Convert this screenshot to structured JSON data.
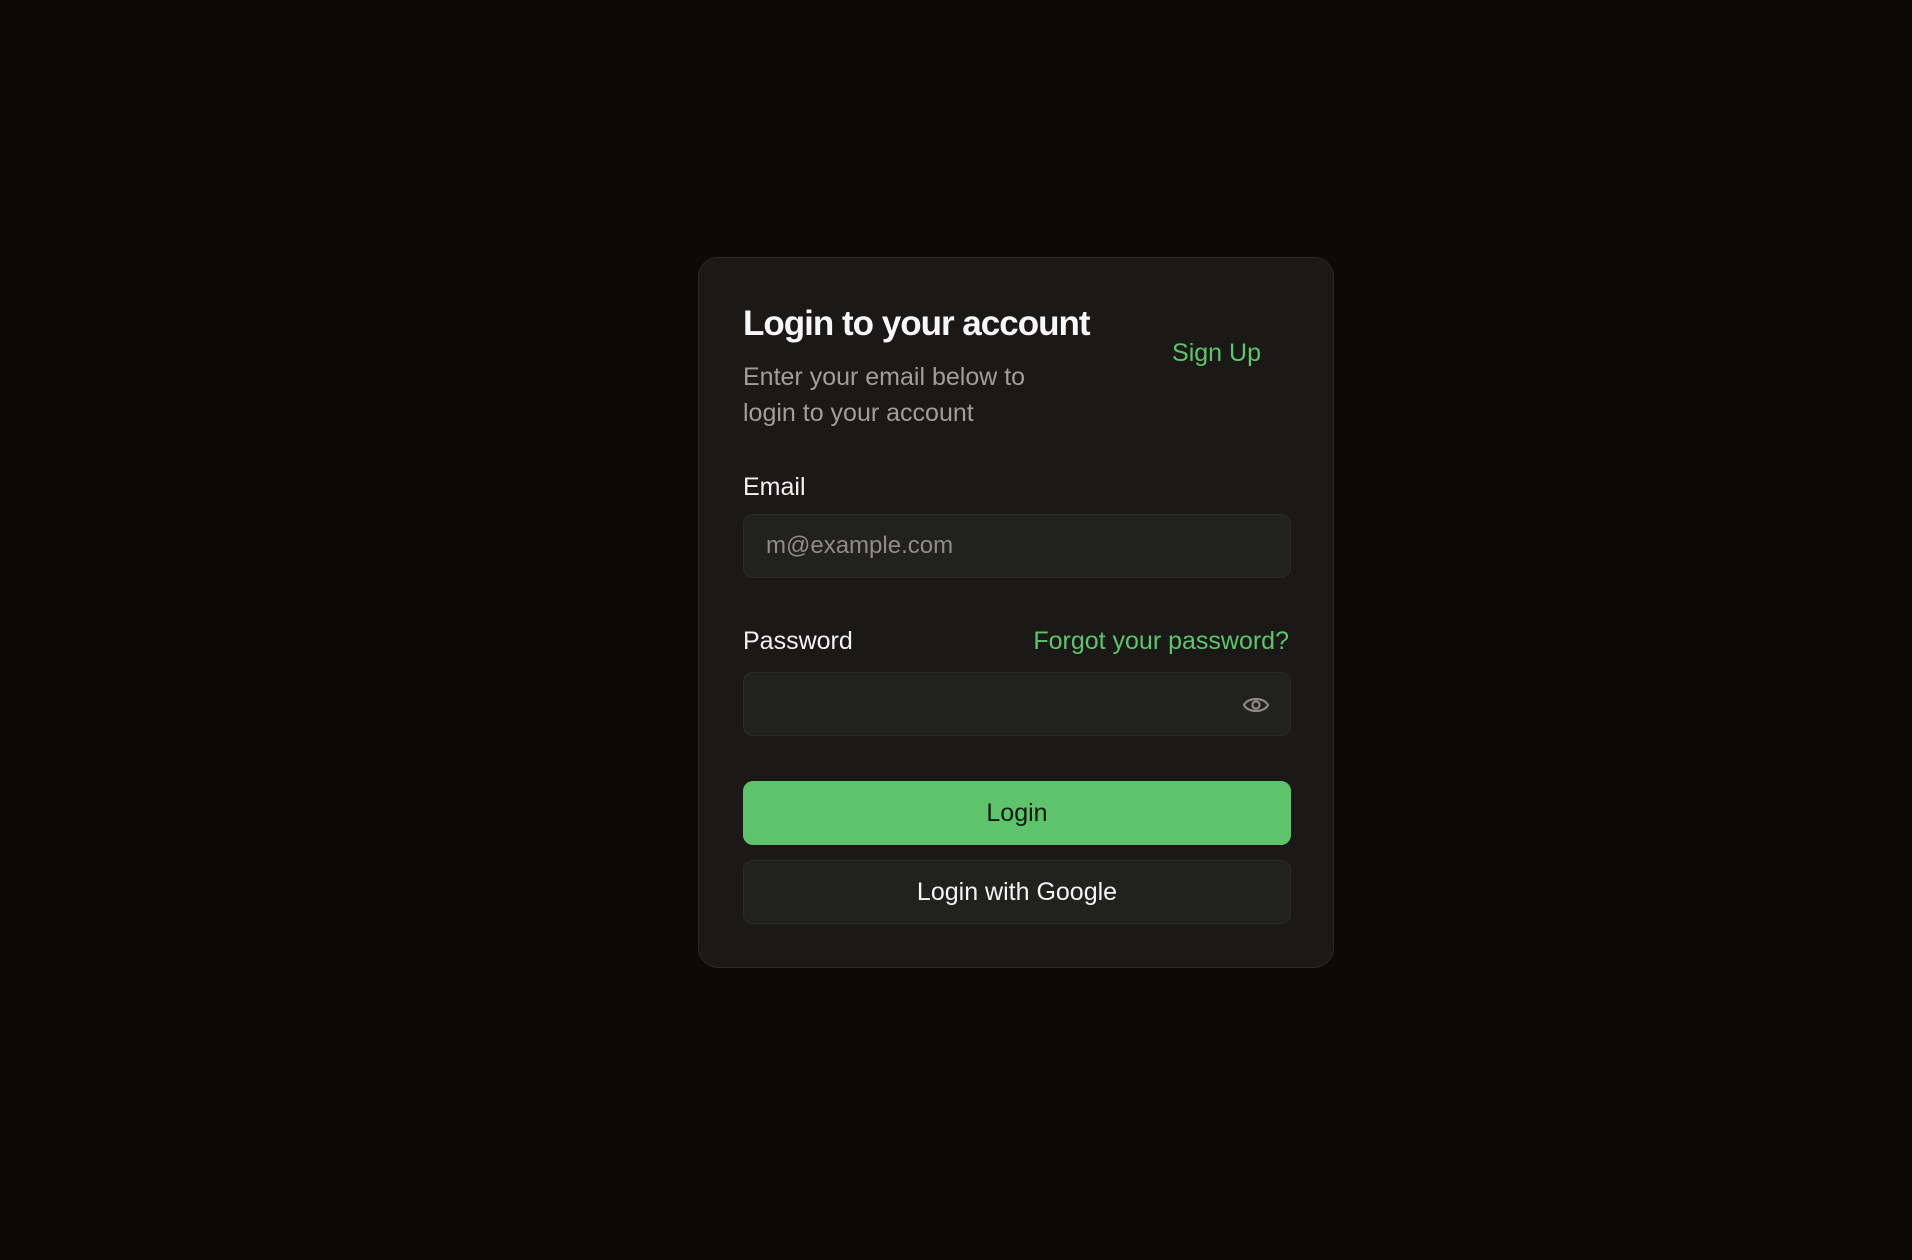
{
  "header": {
    "title": "Login to your account",
    "subtitle": "Enter your email below to login to your account",
    "signup_label": "Sign Up"
  },
  "email": {
    "label": "Email",
    "placeholder": "m@example.com",
    "value": ""
  },
  "password": {
    "label": "Password",
    "forgot_label": "Forgot your password?",
    "value": "",
    "toggle_icon": "eye-icon"
  },
  "actions": {
    "login_label": "Login",
    "google_label": "Login with Google"
  },
  "colors": {
    "accent": "#5fc36b",
    "background": "#0b0a09",
    "card": "#1a1918"
  }
}
